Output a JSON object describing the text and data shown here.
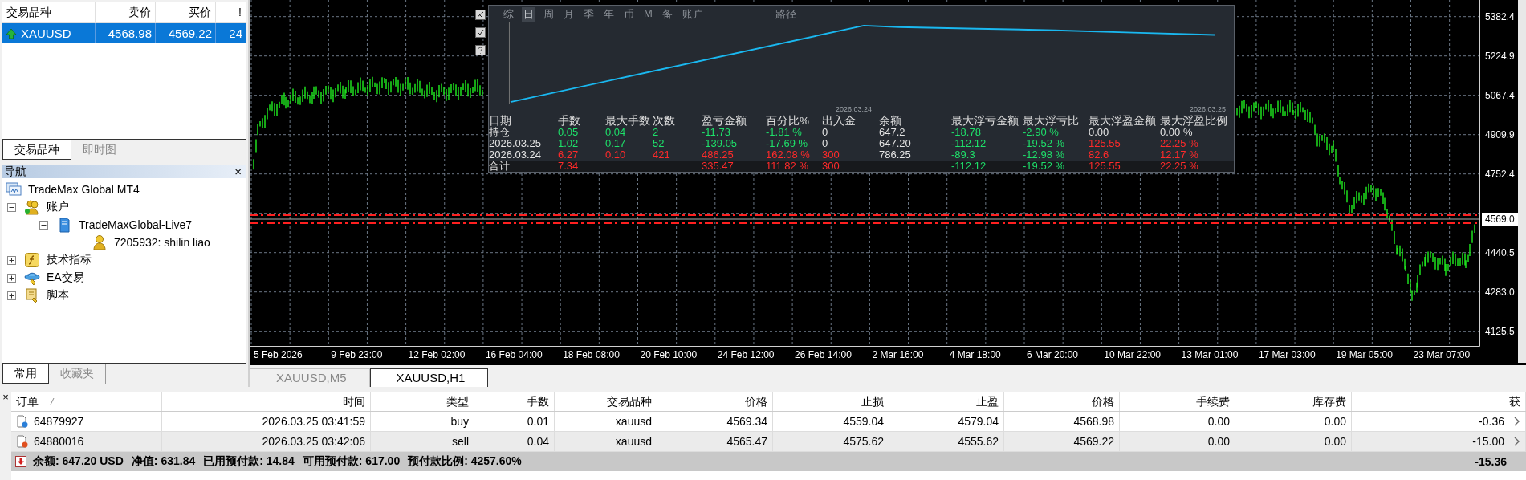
{
  "market_watch": {
    "columns": [
      "交易品种",
      "卖价",
      "买价",
      "!"
    ],
    "rows": [
      {
        "kind": "up",
        "selected": true,
        "cells": [
          "XAUUSD",
          "4568.98",
          "4569.22",
          "24"
        ]
      }
    ],
    "tabs": [
      {
        "label": "交易品种",
        "selected": true
      },
      {
        "label": "即时图",
        "selected": false
      }
    ]
  },
  "navigator": {
    "title": "导航",
    "close": "×",
    "tree": [
      {
        "label": "TradeMax Global MT4",
        "kind": "root",
        "children": [
          {
            "label": "账户",
            "kind": "accounts",
            "expanded": true,
            "children": [
              {
                "label": "TradeMaxGlobal-Live7",
                "kind": "server",
                "expanded": true,
                "children": [
                  {
                    "label": "7205932: shilin liao",
                    "kind": "user"
                  }
                ]
              }
            ]
          },
          {
            "label": "技术指标",
            "kind": "indicators",
            "expanded": false
          },
          {
            "label": "EA交易",
            "kind": "experts",
            "expanded": false
          },
          {
            "label": "脚本",
            "kind": "scripts",
            "expanded": false
          }
        ]
      }
    ],
    "tabs": [
      {
        "label": "常用",
        "selected": true
      },
      {
        "label": "收藏夹",
        "selected": false
      }
    ]
  },
  "chart": {
    "price_labels": [
      "5382.4",
      "5224.9",
      "5067.4",
      "4909.9",
      "4752.4",
      "4440.5",
      "4283.0",
      "4125.5"
    ],
    "current_price": "4569.0",
    "time_labels": [
      "5 Feb 2026",
      "9 Feb 23:00",
      "12 Feb 02:00",
      "16 Feb 04:00",
      "18 Feb 08:00",
      "20 Feb 10:00",
      "24 Feb 12:00",
      "26 Feb 14:00",
      "2 Mar 16:00",
      "4 Mar 18:00",
      "6 Mar 20:00",
      "10 Mar 22:00",
      "13 Mar 01:00",
      "17 Mar 03:00",
      "19 Mar 05:00",
      "23 Mar 07:00"
    ],
    "tabs": [
      {
        "label": "XAUUSD,M5",
        "selected": false
      },
      {
        "label": "XAUUSD,H1",
        "selected": true
      }
    ]
  },
  "stats_panel": {
    "tabs": [
      {
        "label": "综",
        "selected": false
      },
      {
        "label": "日",
        "selected": true
      },
      {
        "label": "周",
        "selected": false
      },
      {
        "label": "月",
        "selected": false
      },
      {
        "label": "季",
        "selected": false
      },
      {
        "label": "年",
        "selected": false
      },
      {
        "label": "币",
        "selected": false
      },
      {
        "label": "M",
        "selected": false
      },
      {
        "label": "备",
        "selected": false
      },
      {
        "label": "账户",
        "selected": false
      }
    ],
    "route_label": "路径",
    "date_labels": [
      "2026.03.24",
      "2026.03.25"
    ],
    "columns": [
      "日期",
      "手数",
      "最大手数",
      "次数",
      "盈亏金额",
      "百分比%",
      "出入金",
      "余额",
      "最大浮亏金额",
      "最大浮亏比",
      "最大浮盈金额",
      "最大浮盈比例"
    ],
    "rows": [
      {
        "kind": "row",
        "cells": [
          {
            "text": "持仓",
            "color": "#e4e4e4"
          },
          {
            "text": "0.05",
            "color": "#1ee06a"
          },
          {
            "text": "0.04",
            "color": "#1ee06a"
          },
          {
            "text": "2",
            "color": "#1ee06a"
          },
          {
            "text": "-11.73",
            "color": "#1ee06a"
          },
          {
            "text": "-1.81 %",
            "color": "#1ee06a"
          },
          {
            "text": "0",
            "color": "#e4e4e4"
          },
          {
            "text": "647.2",
            "color": "#e4e4e4"
          },
          {
            "text": "-18.78",
            "color": "#1ee06a"
          },
          {
            "text": "-2.90 %",
            "color": "#1ee06a"
          },
          {
            "text": "0.00",
            "color": "#e4e4e4"
          },
          {
            "text": "0.00 %",
            "color": "#e4e4e4"
          }
        ]
      },
      {
        "kind": "row",
        "cells": [
          {
            "text": "2026.03.25",
            "color": "#e4e4e4"
          },
          {
            "text": "1.02",
            "color": "#1ee06a"
          },
          {
            "text": "0.17",
            "color": "#1ee06a"
          },
          {
            "text": "52",
            "color": "#1ee06a"
          },
          {
            "text": "-139.05",
            "color": "#1ee06a"
          },
          {
            "text": "-17.69 %",
            "color": "#1ee06a"
          },
          {
            "text": "0",
            "color": "#e4e4e4"
          },
          {
            "text": "647.20",
            "color": "#e4e4e4"
          },
          {
            "text": "-112.12",
            "color": "#1ee06a"
          },
          {
            "text": "-19.52 %",
            "color": "#1ee06a"
          },
          {
            "text": "125.55",
            "color": "#ff2a2a"
          },
          {
            "text": "22.25 %",
            "color": "#ff2a2a"
          }
        ]
      },
      {
        "kind": "row",
        "cells": [
          {
            "text": "2026.03.24",
            "color": "#e4e4e4"
          },
          {
            "text": "6.27",
            "color": "#ff2a2a"
          },
          {
            "text": "0.10",
            "color": "#ff2a2a"
          },
          {
            "text": "421",
            "color": "#ff2a2a"
          },
          {
            "text": "486.25",
            "color": "#ff2a2a"
          },
          {
            "text": "162.08 %",
            "color": "#ff2a2a"
          },
          {
            "text": "300",
            "color": "#ff2a2a"
          },
          {
            "text": "786.25",
            "color": "#e4e4e4"
          },
          {
            "text": "-89.3",
            "color": "#1ee06a"
          },
          {
            "text": "-12.98 %",
            "color": "#1ee06a"
          },
          {
            "text": "82.6",
            "color": "#ff2a2a"
          },
          {
            "text": "12.17 %",
            "color": "#ff2a2a"
          }
        ]
      },
      {
        "kind": "total",
        "cells": [
          {
            "text": "合计",
            "color": "#e4e4e4"
          },
          {
            "text": "7.34",
            "color": "#ff2a2a"
          },
          null,
          null,
          {
            "text": "335.47",
            "color": "#ff2a2a"
          },
          {
            "text": "111.82 %",
            "color": "#ff2a2a"
          },
          {
            "text": "300",
            "color": "#ff2a2a"
          },
          null,
          {
            "text": "-112.12",
            "color": "#1ee06a"
          },
          {
            "text": "-19.52 %",
            "color": "#1ee06a"
          },
          {
            "text": "125.55",
            "color": "#ff2a2a"
          },
          {
            "text": "22.25 %",
            "color": "#ff2a2a"
          }
        ]
      }
    ]
  },
  "terminal": {
    "close": "×",
    "columns": [
      "订单",
      "时间",
      "类型",
      "手数",
      "交易品种",
      "价格",
      "止损",
      "止盈",
      "价格",
      "手续费",
      "库存费",
      "获"
    ],
    "orders": [
      {
        "kind": "buy",
        "cells": [
          "64879927",
          "2026.03.25 03:41:59",
          "buy",
          "0.01",
          "xauusd",
          "4569.34",
          "4559.04",
          "4579.04",
          "4568.98",
          "0.00",
          "0.00",
          "-0.36"
        ]
      },
      {
        "kind": "sell",
        "cells": [
          "64880016",
          "2026.03.25 03:42:06",
          "sell",
          "0.04",
          "xauusd",
          "4565.47",
          "4575.62",
          "4555.62",
          "4569.22",
          "0.00",
          "0.00",
          "-15.00"
        ]
      }
    ],
    "summary": {
      "items": [
        "余额: 647.20 USD",
        "净值: 631.84",
        "已用预付款: 14.84",
        "可用预付款: 617.00",
        "预付款比例: 4257.60%"
      ],
      "total": "-15.36"
    }
  }
}
